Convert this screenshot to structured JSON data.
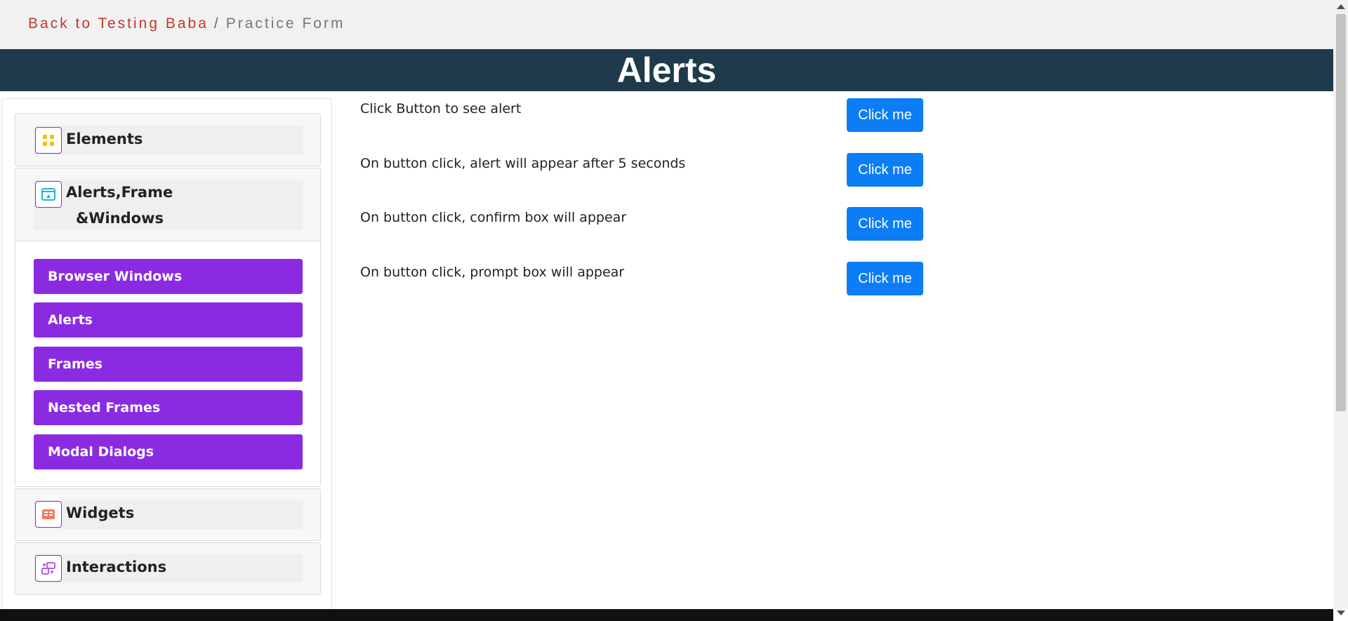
{
  "breadcrumb": {
    "back": "Back to Testing Baba",
    "separator": "/",
    "current": "Practice Form"
  },
  "page_title": "Alerts",
  "sidebar": {
    "groups": [
      {
        "name": "Elements",
        "icon": "elements-grid-icon"
      },
      {
        "name_line1": "Alerts,Frame",
        "name_line2": "&Windows",
        "icon": "window-icon",
        "items": [
          "Browser Windows",
          "Alerts",
          "Frames",
          "Nested Frames",
          "Modal Dialogs"
        ]
      },
      {
        "name": "Widgets",
        "icon": "widgets-icon"
      },
      {
        "name": "Interactions",
        "icon": "interactions-icon"
      }
    ]
  },
  "alerts": [
    {
      "text": "Click Button to see alert",
      "button": "Click me"
    },
    {
      "text": "On button click, alert will appear after 5 seconds",
      "button": "Click me"
    },
    {
      "text": "On button click, confirm box will appear",
      "button": "Click me"
    },
    {
      "text": "On button click, prompt box will appear",
      "button": "Click me"
    }
  ],
  "colors": {
    "accent_purple": "#8a2be2",
    "button_blue": "#0d7df5",
    "banner": "#1f3a4b",
    "breadcrumb_link": "#c0392b"
  }
}
